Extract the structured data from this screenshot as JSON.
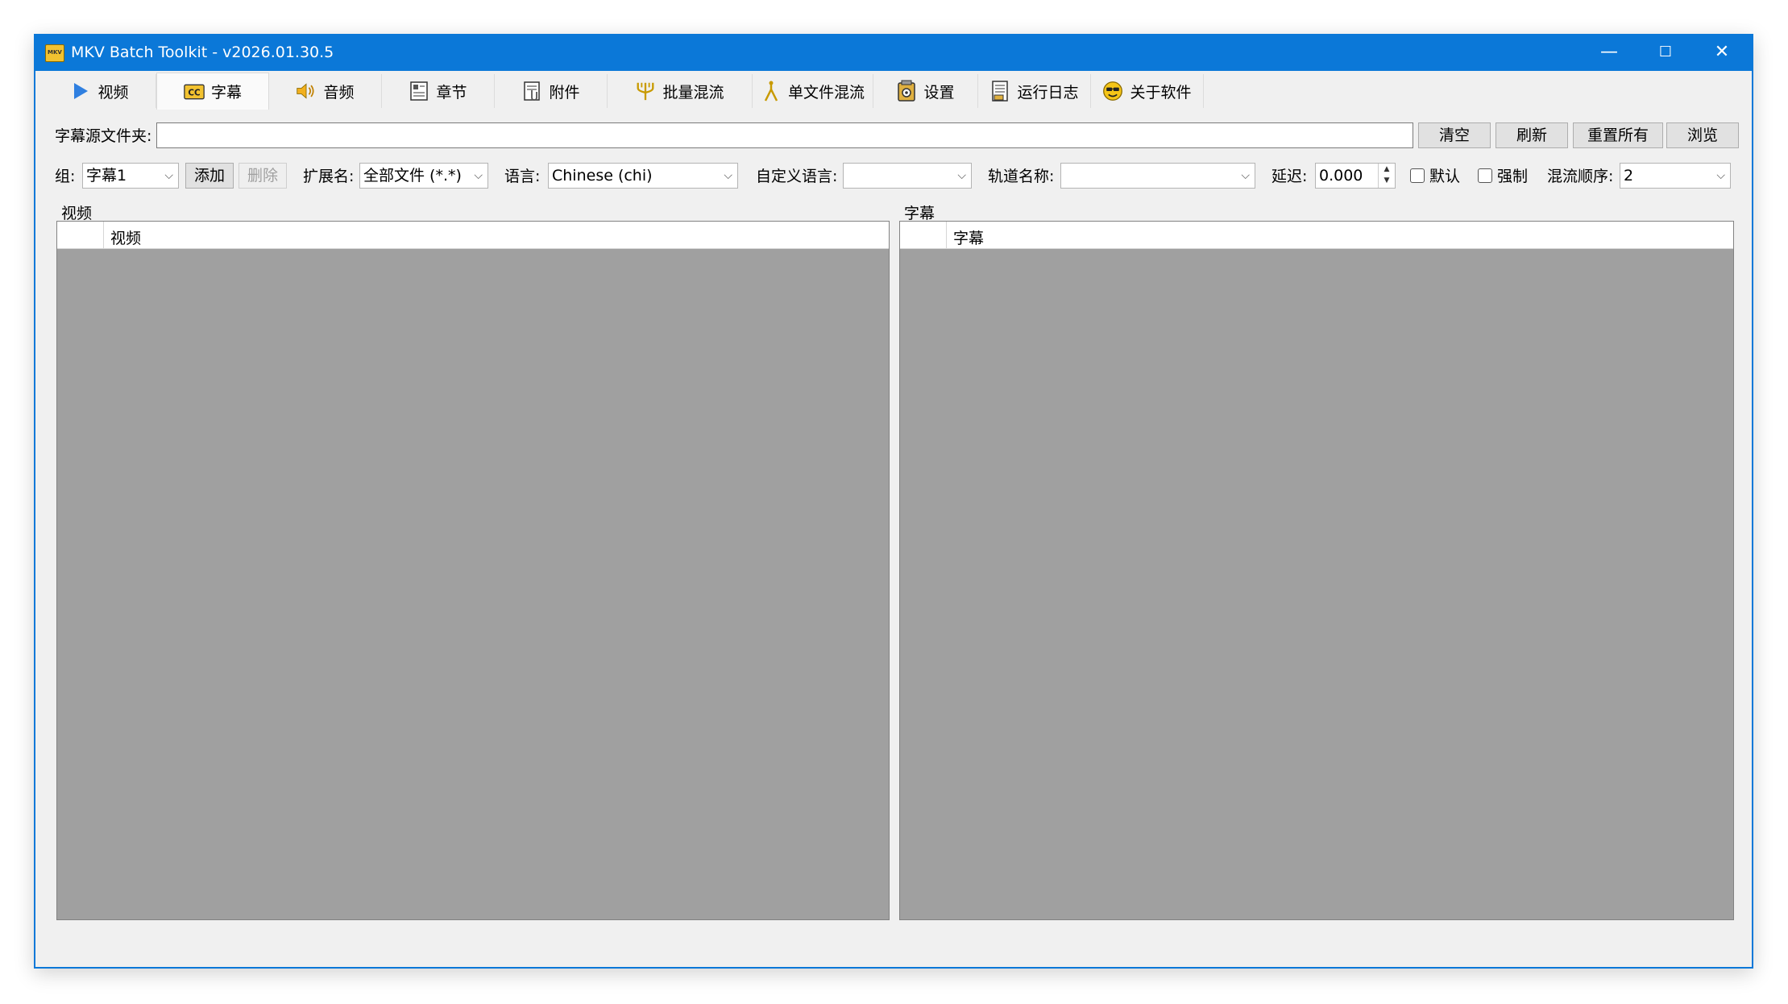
{
  "window": {
    "title": "MKV Batch Toolkit - v2026.01.30.5",
    "icon_label": "MKV",
    "controls": {
      "minimize": "—",
      "maximize": "☐",
      "close": "✕"
    }
  },
  "tabs": [
    {
      "label": "视频",
      "icon": "play-icon"
    },
    {
      "label": "字幕",
      "icon": "cc-icon",
      "active": true
    },
    {
      "label": "音频",
      "icon": "speaker-icon"
    },
    {
      "label": "章节",
      "icon": "chapter-icon"
    },
    {
      "label": "附件",
      "icon": "attachment-icon"
    },
    {
      "label": "批量混流",
      "icon": "batch-merge-icon"
    },
    {
      "label": "单文件混流",
      "icon": "single-merge-icon"
    },
    {
      "label": "设置",
      "icon": "settings-icon"
    },
    {
      "label": "运行日志",
      "icon": "log-icon"
    },
    {
      "label": "关于软件",
      "icon": "about-icon"
    }
  ],
  "source": {
    "label": "字幕源文件夹:",
    "value": "",
    "buttons": {
      "clear": "清空",
      "refresh": "刷新",
      "reset_all": "重置所有",
      "browse": "浏览"
    }
  },
  "options": {
    "group_label": "组:",
    "group_value": "字幕1",
    "add": "添加",
    "delete": "删除",
    "ext_label": "扩展名:",
    "ext_value": "全部文件 (*.*)",
    "lang_label": "语言:",
    "lang_value": "Chinese (chi)",
    "custom_lang_label": "自定义语言:",
    "custom_lang_value": "",
    "track_name_label": "轨道名称:",
    "track_name_value": "",
    "delay_label": "延迟:",
    "delay_value": "0.000",
    "default_label": "默认",
    "forced_label": "强制",
    "order_label": "混流顺序:",
    "order_value": "2"
  },
  "panels": {
    "video": {
      "title": "视频",
      "column": "视频"
    },
    "subtitle": {
      "title": "字幕",
      "column": "字幕"
    }
  },
  "colors": {
    "titlebar": "#0b78d8",
    "list_bg": "#a0a0a0",
    "window_bg": "#f0f0f0"
  }
}
